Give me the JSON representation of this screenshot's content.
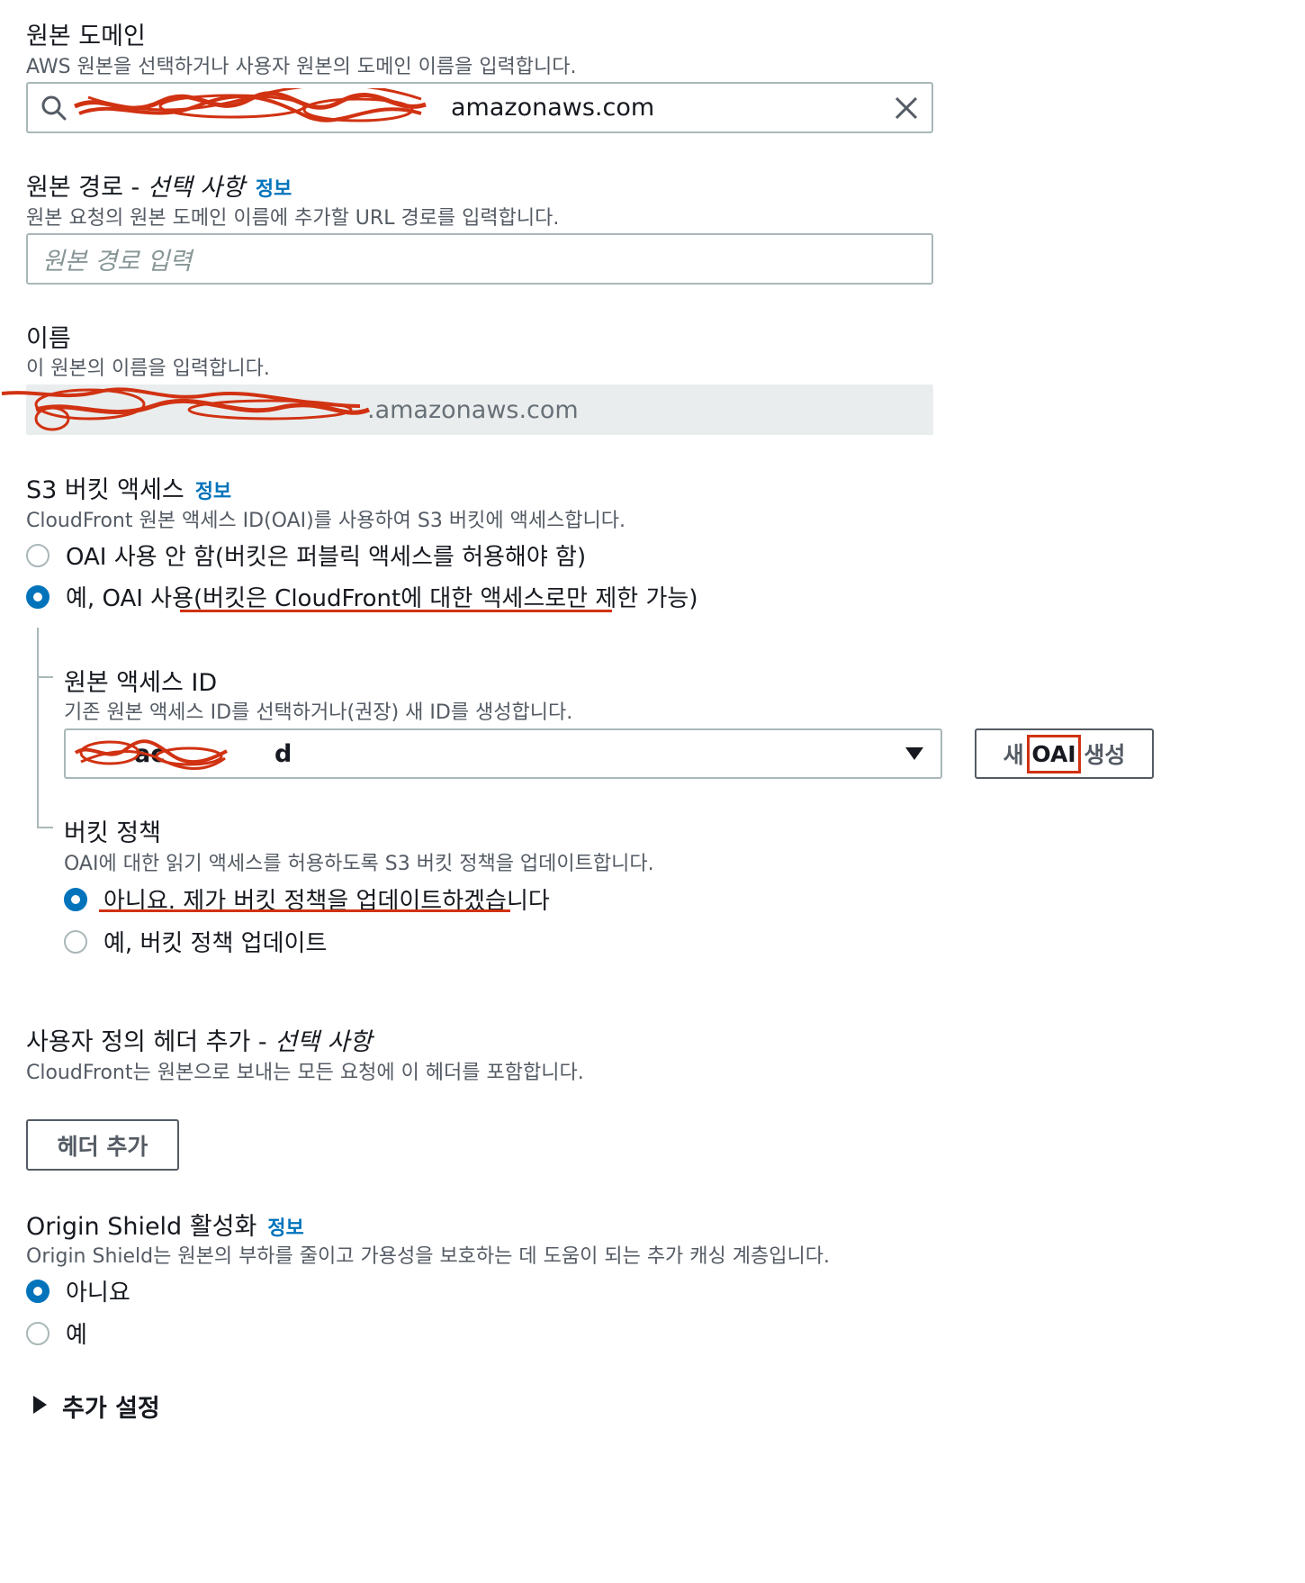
{
  "origin_domain": {
    "label": "원본 도메인",
    "description": "AWS 원본을 선택하거나 사용자 원본의 도메인 이름을 입력합니다.",
    "value_visible": "amazonaws.com"
  },
  "origin_path": {
    "label": "원본 경로 - ",
    "label_optional": "선택 사항",
    "info": "정보",
    "description": "원본 요청의 원본 도메인 이름에 추가할 URL 경로를 입력합니다.",
    "placeholder": "원본 경로 입력"
  },
  "name": {
    "label": "이름",
    "description": "이 원본의 이름을 입력합니다.",
    "value_visible": ".amazonaws.com"
  },
  "s3_access": {
    "label": "S3 버킷 액세스",
    "info": "정보",
    "description": "CloudFront 원본 액세스 ID(OAI)를 사용하여 S3 버킷에 액세스합니다.",
    "options": [
      {
        "label": "OAI 사용 안 함(버킷은 퍼블릭 액세스를 허용해야 함)",
        "checked": false
      },
      {
        "label": "예, OAI 사용(버킷은 CloudFront에 대한 액세스로만 제한 가능)",
        "checked": true
      }
    ]
  },
  "oai": {
    "label": "원본 액세스 ID",
    "description": "기존 원본 액세스 ID를 선택하거나(권장) 새 ID를 생성합니다.",
    "selected_visible": "ac",
    "selected_tail": "d",
    "create_button": {
      "prefix": "새 ",
      "highlight": "OAI",
      "suffix": " 생성"
    }
  },
  "bucket_policy": {
    "label": "버킷 정책",
    "description": "OAI에 대한 읽기 액세스를 허용하도록 S3 버킷 정책을 업데이트합니다.",
    "options": [
      {
        "label": "아니요. 제가 버킷 정책을 업데이트하겠습니다",
        "checked": true
      },
      {
        "label": "예, 버킷 정책 업데이트",
        "checked": false
      }
    ]
  },
  "custom_headers": {
    "label": "사용자 정의 헤더 추가 - ",
    "label_optional": "선택 사항",
    "description": "CloudFront는 원본으로 보내는 모든 요청에 이 헤더를 포함합니다.",
    "button": "헤더 추가"
  },
  "origin_shield": {
    "label": "Origin Shield 활성화",
    "info": "정보",
    "description": "Origin Shield는 원본의 부하를 줄이고 가용성을 보호하는 데 도움이 되는 추가 캐싱 계층입니다.",
    "options": [
      {
        "label": "아니요",
        "checked": true
      },
      {
        "label": "예",
        "checked": false
      }
    ]
  },
  "additional_settings": {
    "label": "추가 설정"
  },
  "colors": {
    "accent": "#0073bb",
    "annotation": "#d13212",
    "border": "#aab7b8"
  }
}
